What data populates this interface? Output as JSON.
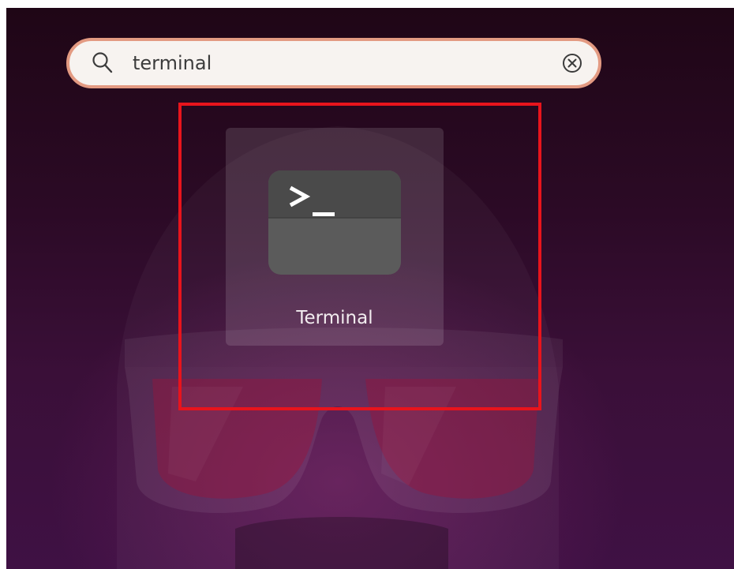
{
  "search": {
    "value": "terminal",
    "icon": "search-icon",
    "clear_icon": "clear-circle-icon"
  },
  "results": [
    {
      "label": "Terminal",
      "icon": "terminal-icon"
    }
  ],
  "colors": {
    "search_border": "#e39a82",
    "search_background": "#f7f3f0",
    "highlight": "#e8141c",
    "terminal_icon_top": "#4f4f4f",
    "terminal_icon_bottom": "#5e5e5e"
  }
}
